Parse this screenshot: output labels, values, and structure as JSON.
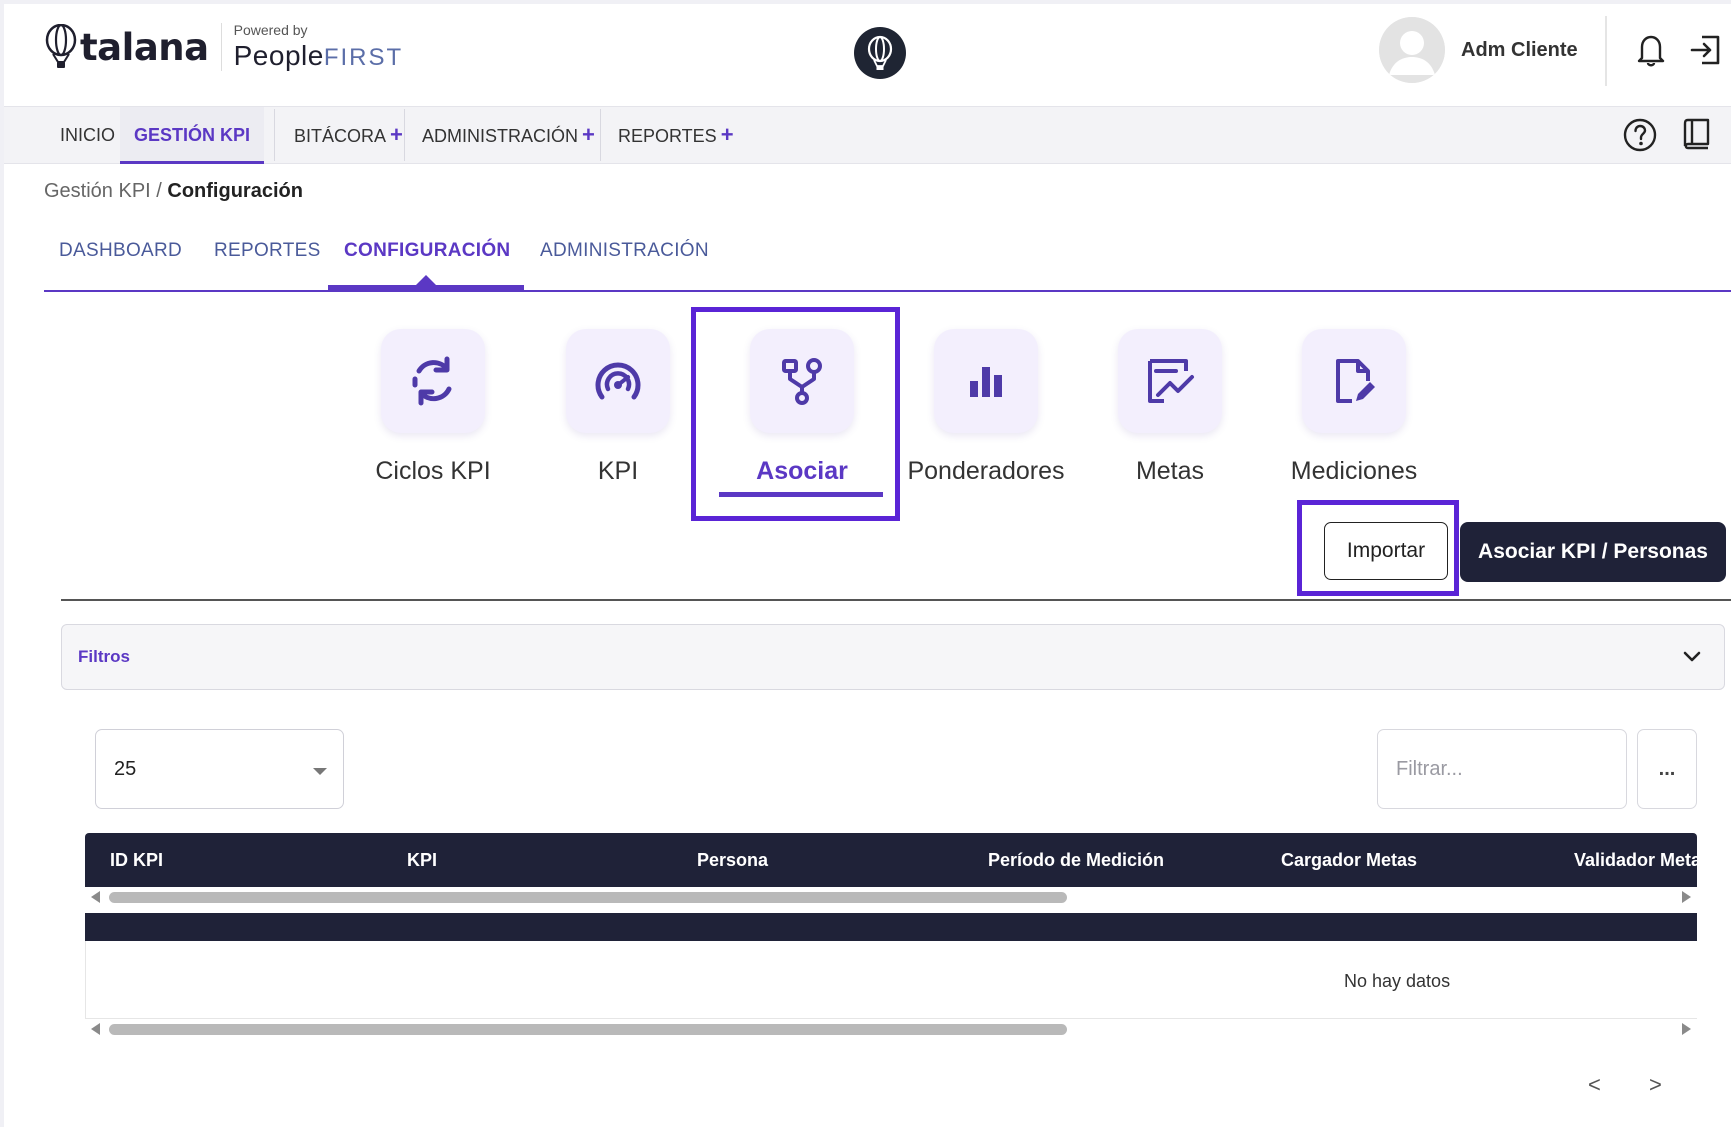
{
  "header": {
    "logo_text": "talana",
    "powered_by": "Powered by",
    "people_a": "People",
    "people_b": "FIRST",
    "user_name": "Adm Cliente"
  },
  "nav": {
    "items": [
      {
        "label": "INICIO"
      },
      {
        "label": "GESTIÓN KPI"
      },
      {
        "label": "BITÁCORA"
      },
      {
        "label": "ADMINISTRACIÓN"
      },
      {
        "label": "REPORTES"
      }
    ],
    "plus": "+"
  },
  "breadcrumb": {
    "parent": "Gestión KPI / ",
    "current": "Configuración"
  },
  "subtabs": [
    {
      "label": "DASHBOARD"
    },
    {
      "label": "REPORTES"
    },
    {
      "label": "CONFIGURACIÓN"
    },
    {
      "label": "ADMINISTRACIÓN"
    }
  ],
  "tiles": [
    {
      "label": "Ciclos KPI",
      "icon": "cycle-icon"
    },
    {
      "label": "KPI",
      "icon": "gauge-icon"
    },
    {
      "label": "Asociar",
      "icon": "flow-icon"
    },
    {
      "label": "Ponderadores",
      "icon": "bar-chart-icon"
    },
    {
      "label": "Metas",
      "icon": "trend-board-icon"
    },
    {
      "label": "Mediciones",
      "icon": "document-edit-icon"
    }
  ],
  "actions": {
    "import_label": "Importar",
    "associate_label": "Asociar KPI / Personas"
  },
  "filters": {
    "label": "Filtros"
  },
  "table_controls": {
    "page_size": "25",
    "filter_placeholder": "Filtrar...",
    "more_label": "..."
  },
  "table": {
    "columns": [
      "ID KPI",
      "KPI",
      "Persona",
      "Período de Medición",
      "Cargador Metas",
      "Validador Meta"
    ],
    "empty_text": "No hay datos"
  },
  "pagination": {
    "prev": "<",
    "next": ">"
  },
  "colors": {
    "accent": "#5b38c4",
    "dark": "#1f2238",
    "tile_bg": "#f3effd",
    "highlight": "#5a24d6"
  }
}
